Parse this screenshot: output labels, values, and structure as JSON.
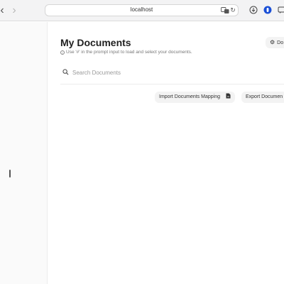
{
  "browser": {
    "address": "localhost",
    "nav_back": "‹",
    "nav_forward": "›",
    "reload": "↻"
  },
  "page": {
    "title": "My Documents",
    "hint": "Use '#' in the prompt input to load and select your documents.",
    "hint_icon": "i",
    "settings_label": "Do",
    "settings_icon": "⚙"
  },
  "search": {
    "placeholder": "Search Documents"
  },
  "actions": {
    "import_label": "Import Documents Mapping",
    "export_label": "Export Documen"
  },
  "icons": {
    "back": "chevron-left-icon",
    "forward": "chevron-right-icon",
    "translate": "translate-icon",
    "reload": "reload-icon",
    "download": "download-icon",
    "password": "password-manager-icon",
    "extension": "extension-icon",
    "settings": "gear-icon",
    "search": "search-icon",
    "import": "file-icon"
  }
}
